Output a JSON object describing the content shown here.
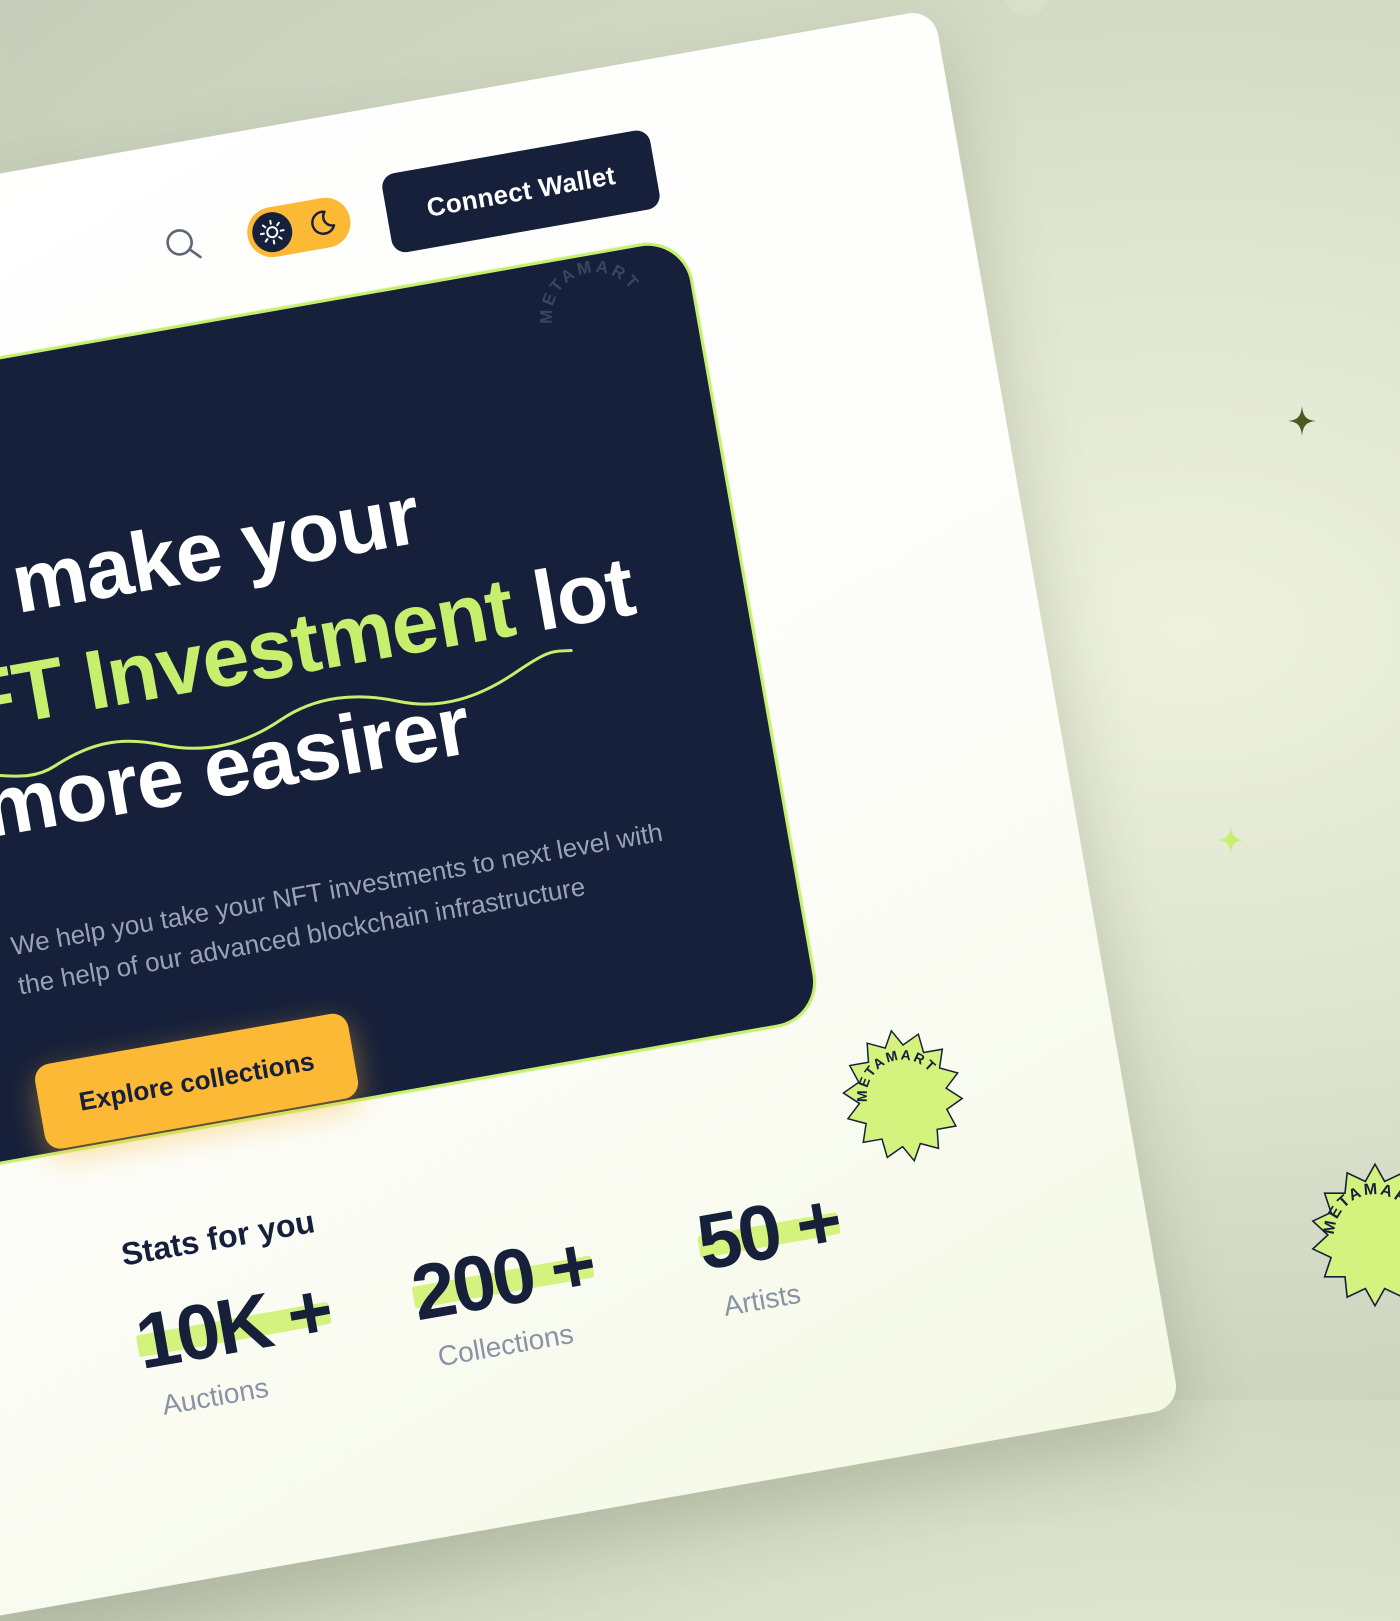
{
  "header": {
    "connect_wallet_label": "Connect Wallet"
  },
  "hero": {
    "headline_line1": "e make your",
    "headline_accent": "FT Investment",
    "headline_line2_rest": " lot",
    "headline_line3": "more easirer",
    "subtitle_line1": "We help you take your NFT investments to next level with",
    "subtitle_line2": "the help of our advanced blockchain infrastructure",
    "explore_label": "Explore collections",
    "badge_text": "METAMART"
  },
  "stats": {
    "title": "Stats for you",
    "items": [
      {
        "value": "10K +",
        "label": "Auctions"
      },
      {
        "value": "200 +",
        "label": "Collections"
      },
      {
        "value": "50 +",
        "label": "Artists"
      }
    ]
  },
  "colors": {
    "navy": "#16203a",
    "lime": "#c7ef6e",
    "amber": "#fbb936",
    "muted": "#9aa3b5"
  },
  "icons": [
    "search-icon",
    "sun-icon",
    "moon-icon",
    "sparkle-icon"
  ]
}
